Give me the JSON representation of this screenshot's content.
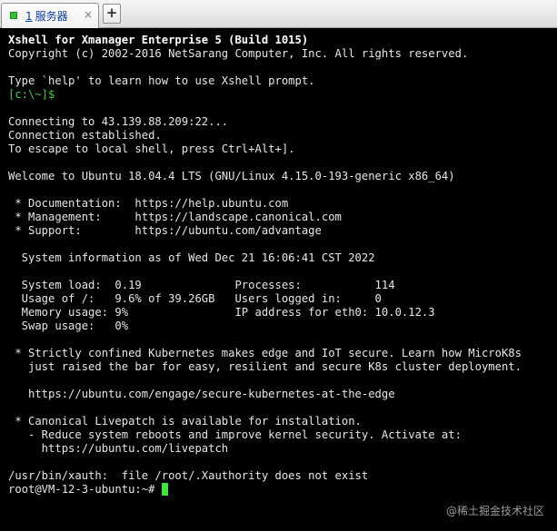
{
  "tab_bar": {
    "tab": {
      "index": "1",
      "title": "服务器",
      "close_glyph": "×",
      "status": "connected",
      "status_color": "#2fc12f"
    },
    "new_tab_glyph": "+"
  },
  "terminal": {
    "banner_title": "Xshell for Xmanager Enterprise 5 (Build 1015)",
    "copyright": "Copyright (c) 2002-2016 NetSarang Computer, Inc. All rights reserved.",
    "help_hint": "Type `help' to learn how to use Xshell prompt.",
    "local_prompt": "[c:\\~]$",
    "connecting": "Connecting to 43.139.88.209:22...",
    "established": "Connection established.",
    "escape_hint": "To escape to local shell, press Ctrl+Alt+].",
    "welcome": "Welcome to Ubuntu 18.04.4 LTS (GNU/Linux 4.15.0-193-generic x86_64)",
    "doc_line": " * Documentation:  https://help.ubuntu.com",
    "mgmt_line": " * Management:     https://landscape.canonical.com",
    "support_line": " * Support:        https://ubuntu.com/advantage",
    "sysinfo": "  System information as of Wed Dec 21 16:06:41 CST 2022",
    "sys_row1": "  System load:  0.19              Processes:           114",
    "sys_row2": "  Usage of /:   9.6% of 39.26GB   Users logged in:     0",
    "sys_row3": "  Memory usage: 9%                IP address for eth0: 10.0.12.3",
    "sys_row4": "  Swap usage:   0%",
    "k8s_line1": " * Strictly confined Kubernetes makes edge and IoT secure. Learn how MicroK8s",
    "k8s_line2": "   just raised the bar for easy, resilient and secure K8s cluster deployment.",
    "k8s_url": "   https://ubuntu.com/engage/secure-kubernetes-at-the-edge",
    "livepatch_line1": " * Canonical Livepatch is available for installation.",
    "livepatch_line2": "   - Reduce system reboots and improve kernel security. Activate at:",
    "livepatch_url": "     https://ubuntu.com/livepatch",
    "xauth_msg": "/usr/bin/xauth:  file /root/.Xauthority does not exist",
    "remote_prompt": "root@VM-12-3-ubuntu:~# ",
    "cursor_color": "#39e839"
  },
  "watermark": "@稀土掘金技术社区"
}
